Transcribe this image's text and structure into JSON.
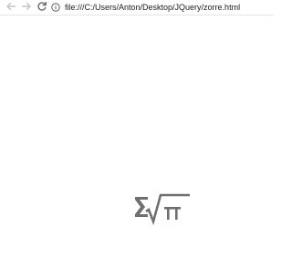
{
  "browser": {
    "url": "file:///C:/Users/Anton/Desktop/JQuery/zorre.html",
    "icons": {
      "back": "arrow-left-icon",
      "forward": "arrow-right-icon",
      "reload": "reload-icon",
      "info": "info-icon"
    }
  },
  "page": {
    "logo": "sigma-root-pi-logo",
    "logo_color": "#6f6f6f"
  }
}
